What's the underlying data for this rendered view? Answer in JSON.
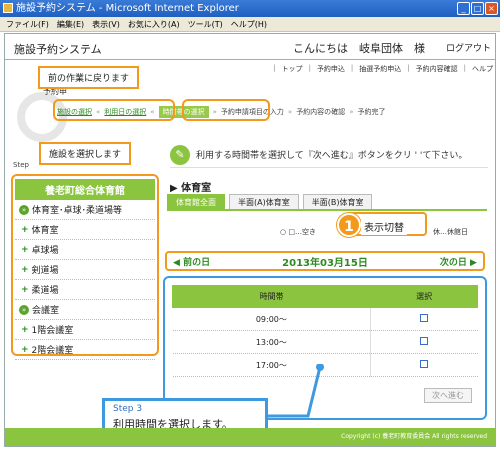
{
  "window": {
    "title": "施設予約システム - Microsoft Internet Explorer"
  },
  "menu": [
    "ファイル(F)",
    "編集(E)",
    "表示(V)",
    "お気に入り(A)",
    "ツール(T)",
    "ヘルプ(H)"
  ],
  "header": {
    "system_title": "施設予約システム",
    "greeting": "こんにちは　岐阜団体　様",
    "logout": "ログアウト"
  },
  "topnav": [
    "トップ",
    "予約申込",
    "抽選予約申込",
    "予約内容確認",
    "ヘルプ"
  ],
  "steps_label": "予約申",
  "steps": [
    {
      "label": "施設の選択",
      "state": "done"
    },
    {
      "label": "利用日の選択",
      "state": "done"
    },
    {
      "label": "時間帯の選択",
      "state": "current"
    },
    {
      "label": "予約申請項目の入力",
      "state": "todo"
    },
    {
      "label": "予約内容の確認",
      "state": "todo"
    },
    {
      "label": "予約完了",
      "state": "todo"
    }
  ],
  "callouts": {
    "back": "前の作業に戻ります",
    "select_facility": "施設を選択します"
  },
  "step_left_text": "Step",
  "sidebar": {
    "title": "養老町総合体育館",
    "items": [
      {
        "label": "体育室･卓球･柔道場等",
        "type": "group"
      },
      {
        "label": "体育室",
        "type": "sub"
      },
      {
        "label": "卓球場",
        "type": "sub"
      },
      {
        "label": "剣道場",
        "type": "sub"
      },
      {
        "label": "柔道場",
        "type": "sub"
      },
      {
        "label": "会議室",
        "type": "group"
      },
      {
        "label": "1階会議室",
        "type": "sub"
      },
      {
        "label": "2階会議室",
        "type": "sub"
      }
    ]
  },
  "instruction": "利用する時間帯を選択して『次へ進む』ボタンをクリ ' 'て下さい。",
  "room_title": "体育室",
  "tabs": [
    "体育館全面",
    "半面(A)体育室",
    "半面(B)体育室"
  ],
  "legend_left": "○ □…空き",
  "legend_right": "休…休館日",
  "switch": {
    "num": "1",
    "label": "表示切替"
  },
  "daynav": {
    "prev": "前の日",
    "date": "2013年03月15日",
    "next": "次の日"
  },
  "table": {
    "headers": [
      "時間帯",
      "選択"
    ],
    "rows": [
      {
        "time": "09:00～"
      },
      {
        "time": "13:00～"
      },
      {
        "time": "17:00～"
      }
    ]
  },
  "next_button": "次へ進む",
  "step3": {
    "step": "Step 3",
    "text": "利用時間を選択します。"
  },
  "footer": "Copyright (c) 養老町教育委員会 All rights reserved",
  "colors": {
    "accent_green": "#8bc43f",
    "callout_orange": "#f39a1c",
    "highlight_blue": "#3d9ae0"
  }
}
